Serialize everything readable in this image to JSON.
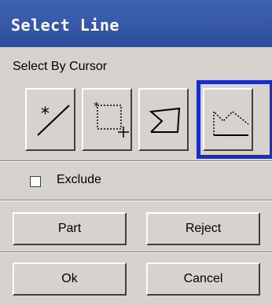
{
  "window": {
    "title": "Select Line"
  },
  "select_by": {
    "label": "Select By Cursor",
    "tools": [
      {
        "name": "pick-single-icon"
      },
      {
        "name": "box-select-icon"
      },
      {
        "name": "polygon-select-icon"
      },
      {
        "name": "chain-select-icon",
        "selected": true
      }
    ]
  },
  "exclude": {
    "label": "Exclude",
    "checked": false
  },
  "buttons": {
    "part": "Part",
    "reject": "Reject",
    "ok": "Ok",
    "cancel": "Cancel"
  },
  "colors": {
    "title_bar": "#2c4e9c",
    "selection": "#1d2cc6",
    "face": "#d6d3ce"
  }
}
